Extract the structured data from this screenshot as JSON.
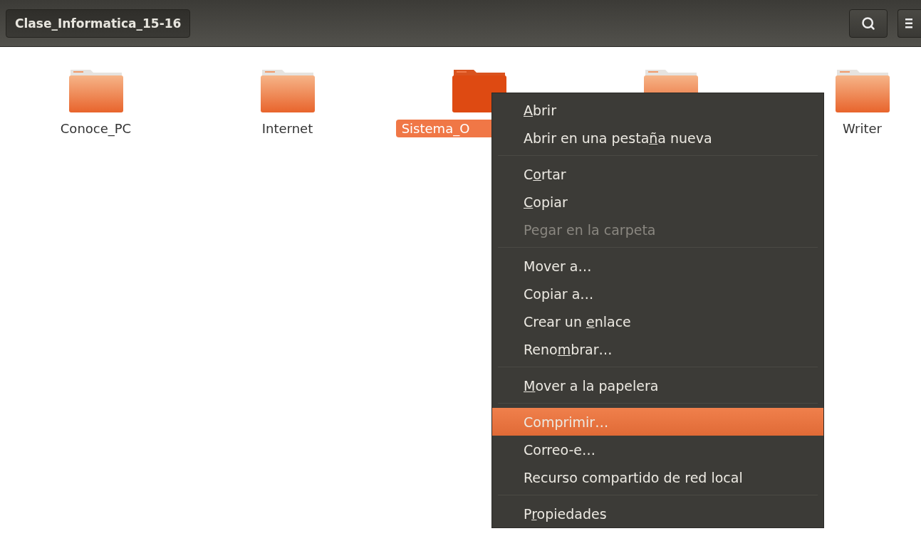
{
  "header": {
    "path_button": "Clase_Informatica_15-16"
  },
  "folders": [
    {
      "label": "Conoce_PC",
      "selected": false
    },
    {
      "label": "Internet",
      "selected": false
    },
    {
      "label": "Sistema_O",
      "selected": true
    },
    {
      "selected": false
    },
    {
      "label": "Writer",
      "selected": false
    }
  ],
  "context_menu": {
    "groups": [
      [
        {
          "key": "A",
          "post": "brir",
          "disabled": false,
          "selected": false
        },
        {
          "pre": "Abrir en una pesta",
          "key": "ñ",
          "post": "a nueva",
          "disabled": false,
          "selected": false
        }
      ],
      [
        {
          "pre": "C",
          "key": "o",
          "post": "rtar",
          "disabled": false,
          "selected": false
        },
        {
          "key": "C",
          "post": "opiar",
          "disabled": false,
          "selected": false
        },
        {
          "pre": "Pegar en la carpeta",
          "disabled": true,
          "selected": false
        }
      ],
      [
        {
          "pre": "Mover a…",
          "disabled": false,
          "selected": false
        },
        {
          "pre": "Copiar a…",
          "disabled": false,
          "selected": false
        },
        {
          "pre": "Crear un ",
          "key": "e",
          "post": "nlace",
          "disabled": false,
          "selected": false
        },
        {
          "pre": "Reno",
          "key": "m",
          "post": "brar…",
          "disabled": false,
          "selected": false
        }
      ],
      [
        {
          "key": "M",
          "post": "over a la papelera",
          "disabled": false,
          "selected": false
        }
      ],
      [
        {
          "pre": "Comprimir…",
          "disabled": false,
          "selected": true
        },
        {
          "pre": "Correo-e…",
          "disabled": false,
          "selected": false
        },
        {
          "pre": "Recurso compartido de red local",
          "disabled": false,
          "selected": false
        }
      ],
      [
        {
          "pre": "P",
          "key": "r",
          "post": "opiedades",
          "disabled": false,
          "selected": false
        }
      ]
    ]
  }
}
